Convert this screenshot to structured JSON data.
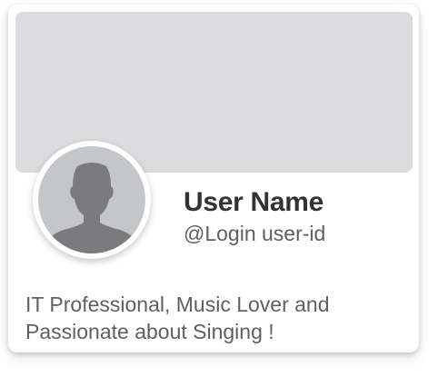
{
  "profile": {
    "name": "User Name",
    "login": "@Login user-id",
    "bio_line1": "IT Professional, Music Lover and",
    "bio_line2": "Passionate about Singing !"
  },
  "colors": {
    "cover": "#dcdcde",
    "avatar_bg": "#c4c6c9",
    "avatar_silhouette": "#7b7b7d",
    "name_text": "#333333",
    "secondary_text": "#5f5f5f"
  },
  "icons": {
    "avatar": "user-silhouette-icon"
  }
}
